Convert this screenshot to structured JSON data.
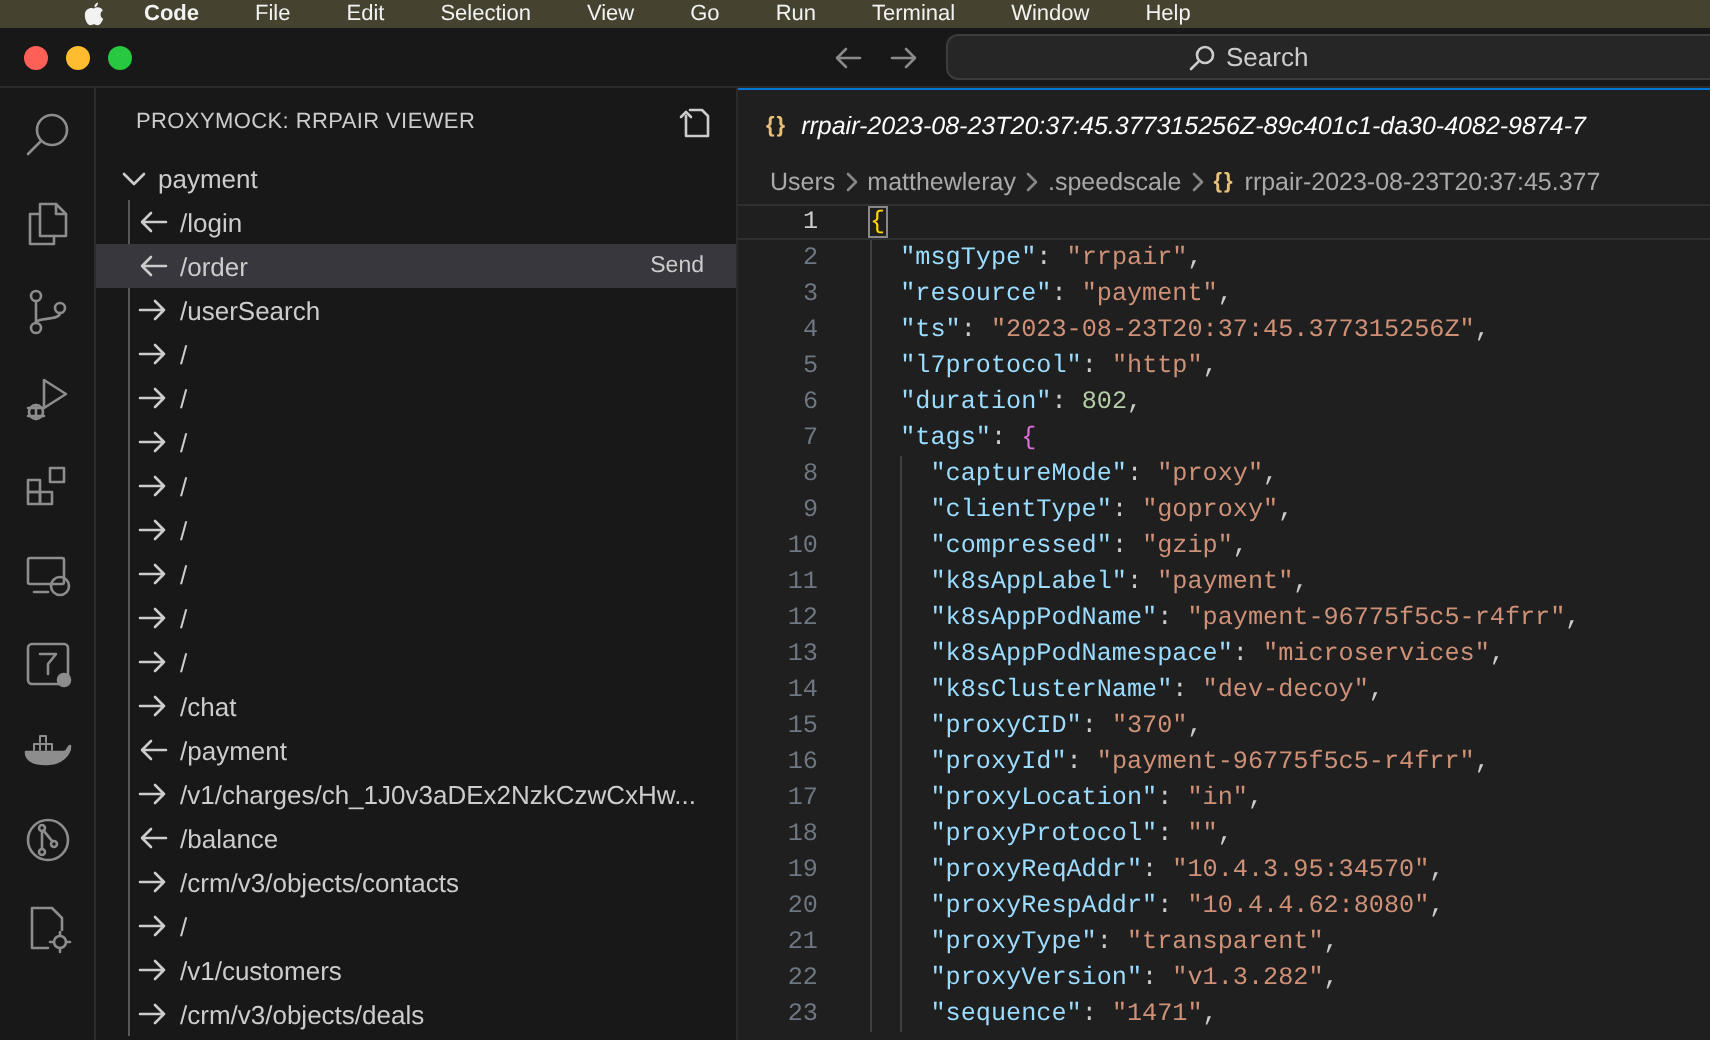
{
  "menu_bar": {
    "items": [
      {
        "label": "Code",
        "bold": true
      },
      {
        "label": "File",
        "bold": false
      },
      {
        "label": "Edit",
        "bold": false
      },
      {
        "label": "Selection",
        "bold": false
      },
      {
        "label": "View",
        "bold": false
      },
      {
        "label": "Go",
        "bold": false
      },
      {
        "label": "Run",
        "bold": false
      },
      {
        "label": "Terminal",
        "bold": false
      },
      {
        "label": "Window",
        "bold": false
      },
      {
        "label": "Help",
        "bold": false
      }
    ]
  },
  "title_bar": {
    "search": {
      "label": "Search"
    }
  },
  "sidebar": {
    "title": "PROXYMOCK: RRPAIR VIEWER",
    "tree": [
      {
        "label": "payment",
        "expanded": true,
        "children": [
          {
            "label": "/login",
            "kind": "left",
            "selected": false
          },
          {
            "label": "/order",
            "kind": "left",
            "selected": true,
            "action": "Send"
          },
          {
            "label": "/userSearch",
            "kind": "right",
            "selected": false
          },
          {
            "label": "/",
            "kind": "right",
            "selected": false
          },
          {
            "label": "/",
            "kind": "right",
            "selected": false
          },
          {
            "label": "/",
            "kind": "right",
            "selected": false
          },
          {
            "label": "/",
            "kind": "right",
            "selected": false
          },
          {
            "label": "/",
            "kind": "right",
            "selected": false
          },
          {
            "label": "/",
            "kind": "right",
            "selected": false
          },
          {
            "label": "/",
            "kind": "right",
            "selected": false
          },
          {
            "label": "/",
            "kind": "right",
            "selected": false
          },
          {
            "label": "/chat",
            "kind": "right",
            "selected": false
          },
          {
            "label": "/payment",
            "kind": "left",
            "selected": false
          },
          {
            "label": "/v1/charges/ch_1J0v3aDEx2NzkCzwCxHw...",
            "kind": "right",
            "selected": false
          },
          {
            "label": "/balance",
            "kind": "left",
            "selected": false
          },
          {
            "label": "/crm/v3/objects/contacts",
            "kind": "right",
            "selected": false
          },
          {
            "label": "/",
            "kind": "right",
            "selected": false
          },
          {
            "label": "/v1/customers",
            "kind": "right",
            "selected": false
          },
          {
            "label": "/crm/v3/objects/deals",
            "kind": "right",
            "selected": false
          }
        ]
      }
    ]
  },
  "editor": {
    "tab": {
      "icon": "{}",
      "title": "rrpair-2023-08-23T20:37:45.377315256Z-89c401c1-da30-4082-9874-7"
    },
    "breadcrumbs": [
      {
        "label": "Users"
      },
      {
        "label": "matthewleray"
      },
      {
        "label": ".speedscale"
      },
      {
        "icon": "{}",
        "label": "rrpair-2023-08-23T20:37:45.377"
      }
    ],
    "lines": [
      {
        "number": "1",
        "current": true,
        "tokens": [
          {
            "kind": "brace",
            "text": "{"
          }
        ],
        "children": [
          {
            "number": "2",
            "current": false,
            "tokens": [
              {
                "kind": "key",
                "text": "\"msgType\""
              },
              {
                "kind": "punct",
                "text": ": "
              },
              {
                "kind": "string",
                "text": "\"rrpair\""
              },
              {
                "kind": "punct",
                "text": ","
              }
            ]
          },
          {
            "number": "3",
            "current": false,
            "tokens": [
              {
                "kind": "key",
                "text": "\"resource\""
              },
              {
                "kind": "punct",
                "text": ": "
              },
              {
                "kind": "string",
                "text": "\"payment\""
              },
              {
                "kind": "punct",
                "text": ","
              }
            ]
          },
          {
            "number": "4",
            "current": false,
            "tokens": [
              {
                "kind": "key",
                "text": "\"ts\""
              },
              {
                "kind": "punct",
                "text": ": "
              },
              {
                "kind": "string",
                "text": "\"2023-08-23T20:37:45.377315256Z\""
              },
              {
                "kind": "punct",
                "text": ","
              }
            ]
          },
          {
            "number": "5",
            "current": false,
            "tokens": [
              {
                "kind": "key",
                "text": "\"l7protocol\""
              },
              {
                "kind": "punct",
                "text": ": "
              },
              {
                "kind": "string",
                "text": "\"http\""
              },
              {
                "kind": "punct",
                "text": ","
              }
            ]
          },
          {
            "number": "6",
            "current": false,
            "tokens": [
              {
                "kind": "key",
                "text": "\"duration\""
              },
              {
                "kind": "punct",
                "text": ": "
              },
              {
                "kind": "number",
                "text": "802"
              },
              {
                "kind": "punct",
                "text": ","
              }
            ]
          },
          {
            "number": "7",
            "current": false,
            "tokens": [
              {
                "kind": "key",
                "text": "\"tags\""
              },
              {
                "kind": "punct",
                "text": ": "
              },
              {
                "kind": "brace",
                "text": "{"
              }
            ],
            "children": [
              {
                "number": "8",
                "current": false,
                "tokens": [
                  {
                    "kind": "key",
                    "text": "\"captureMode\""
                  },
                  {
                    "kind": "punct",
                    "text": ": "
                  },
                  {
                    "kind": "string",
                    "text": "\"proxy\""
                  },
                  {
                    "kind": "punct",
                    "text": ","
                  }
                ]
              },
              {
                "number": "9",
                "current": false,
                "tokens": [
                  {
                    "kind": "key",
                    "text": "\"clientType\""
                  },
                  {
                    "kind": "punct",
                    "text": ": "
                  },
                  {
                    "kind": "string",
                    "text": "\"goproxy\""
                  },
                  {
                    "kind": "punct",
                    "text": ","
                  }
                ]
              },
              {
                "number": "10",
                "current": false,
                "tokens": [
                  {
                    "kind": "key",
                    "text": "\"compressed\""
                  },
                  {
                    "kind": "punct",
                    "text": ": "
                  },
                  {
                    "kind": "string",
                    "text": "\"gzip\""
                  },
                  {
                    "kind": "punct",
                    "text": ","
                  }
                ]
              },
              {
                "number": "11",
                "current": false,
                "tokens": [
                  {
                    "kind": "key",
                    "text": "\"k8sAppLabel\""
                  },
                  {
                    "kind": "punct",
                    "text": ": "
                  },
                  {
                    "kind": "string",
                    "text": "\"payment\""
                  },
                  {
                    "kind": "punct",
                    "text": ","
                  }
                ]
              },
              {
                "number": "12",
                "current": false,
                "tokens": [
                  {
                    "kind": "key",
                    "text": "\"k8sAppPodName\""
                  },
                  {
                    "kind": "punct",
                    "text": ": "
                  },
                  {
                    "kind": "string",
                    "text": "\"payment-96775f5c5-r4frr\""
                  },
                  {
                    "kind": "punct",
                    "text": ","
                  }
                ]
              },
              {
                "number": "13",
                "current": false,
                "tokens": [
                  {
                    "kind": "key",
                    "text": "\"k8sAppPodNamespace\""
                  },
                  {
                    "kind": "punct",
                    "text": ": "
                  },
                  {
                    "kind": "string",
                    "text": "\"microservices\""
                  },
                  {
                    "kind": "punct",
                    "text": ","
                  }
                ]
              },
              {
                "number": "14",
                "current": false,
                "tokens": [
                  {
                    "kind": "key",
                    "text": "\"k8sClusterName\""
                  },
                  {
                    "kind": "punct",
                    "text": ": "
                  },
                  {
                    "kind": "string",
                    "text": "\"dev-decoy\""
                  },
                  {
                    "kind": "punct",
                    "text": ","
                  }
                ]
              },
              {
                "number": "15",
                "current": false,
                "tokens": [
                  {
                    "kind": "key",
                    "text": "\"proxyCID\""
                  },
                  {
                    "kind": "punct",
                    "text": ": "
                  },
                  {
                    "kind": "string",
                    "text": "\"370\""
                  },
                  {
                    "kind": "punct",
                    "text": ","
                  }
                ]
              },
              {
                "number": "16",
                "current": false,
                "tokens": [
                  {
                    "kind": "key",
                    "text": "\"proxyId\""
                  },
                  {
                    "kind": "punct",
                    "text": ": "
                  },
                  {
                    "kind": "string",
                    "text": "\"payment-96775f5c5-r4frr\""
                  },
                  {
                    "kind": "punct",
                    "text": ","
                  }
                ]
              },
              {
                "number": "17",
                "current": false,
                "tokens": [
                  {
                    "kind": "key",
                    "text": "\"proxyLocation\""
                  },
                  {
                    "kind": "punct",
                    "text": ": "
                  },
                  {
                    "kind": "string",
                    "text": "\"in\""
                  },
                  {
                    "kind": "punct",
                    "text": ","
                  }
                ]
              },
              {
                "number": "18",
                "current": false,
                "tokens": [
                  {
                    "kind": "key",
                    "text": "\"proxyProtocol\""
                  },
                  {
                    "kind": "punct",
                    "text": ": "
                  },
                  {
                    "kind": "string",
                    "text": "\"\""
                  },
                  {
                    "kind": "punct",
                    "text": ","
                  }
                ]
              },
              {
                "number": "19",
                "current": false,
                "tokens": [
                  {
                    "kind": "key",
                    "text": "\"proxyReqAddr\""
                  },
                  {
                    "kind": "punct",
                    "text": ": "
                  },
                  {
                    "kind": "string",
                    "text": "\"10.4.3.95:34570\""
                  },
                  {
                    "kind": "punct",
                    "text": ","
                  }
                ]
              },
              {
                "number": "20",
                "current": false,
                "tokens": [
                  {
                    "kind": "key",
                    "text": "\"proxyRespAddr\""
                  },
                  {
                    "kind": "punct",
                    "text": ": "
                  },
                  {
                    "kind": "string",
                    "text": "\"10.4.4.62:8080\""
                  },
                  {
                    "kind": "punct",
                    "text": ","
                  }
                ]
              },
              {
                "number": "21",
                "current": false,
                "tokens": [
                  {
                    "kind": "key",
                    "text": "\"proxyType\""
                  },
                  {
                    "kind": "punct",
                    "text": ": "
                  },
                  {
                    "kind": "string",
                    "text": "\"transparent\""
                  },
                  {
                    "kind": "punct",
                    "text": ","
                  }
                ]
              },
              {
                "number": "22",
                "current": false,
                "tokens": [
                  {
                    "kind": "key",
                    "text": "\"proxyVersion\""
                  },
                  {
                    "kind": "punct",
                    "text": ": "
                  },
                  {
                    "kind": "string",
                    "text": "\"v1.3.282\""
                  },
                  {
                    "kind": "punct",
                    "text": ","
                  }
                ]
              },
              {
                "number": "23",
                "current": false,
                "tokens": [
                  {
                    "kind": "key",
                    "text": "\"sequence\""
                  },
                  {
                    "kind": "punct",
                    "text": ": "
                  },
                  {
                    "kind": "string",
                    "text": "\"1471\""
                  },
                  {
                    "kind": "punct",
                    "text": ","
                  }
                ]
              }
            ]
          }
        ]
      }
    ]
  }
}
